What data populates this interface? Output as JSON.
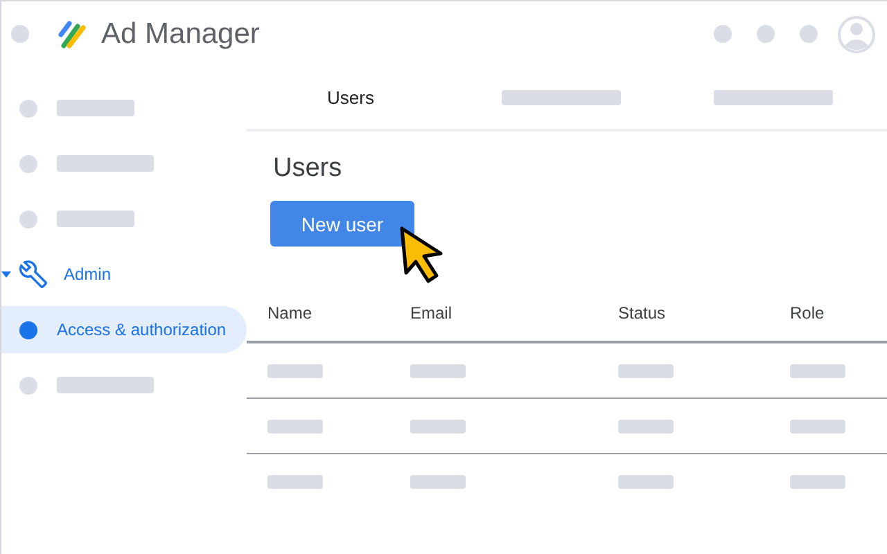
{
  "app": {
    "title": "Ad Manager"
  },
  "sidebar": {
    "items": [
      {
        "kind": "placeholder",
        "selected": false
      },
      {
        "kind": "placeholder",
        "selected": false
      },
      {
        "kind": "placeholder",
        "selected": false
      },
      {
        "kind": "section",
        "label": "Admin",
        "expanded": true,
        "selected": false
      },
      {
        "kind": "link",
        "label": "Access & authorization",
        "selected": true
      },
      {
        "kind": "placeholder",
        "selected": false
      }
    ]
  },
  "tabs": [
    {
      "kind": "text",
      "label": "Users"
    },
    {
      "kind": "placeholder"
    },
    {
      "kind": "placeholder"
    }
  ],
  "page": {
    "heading": "Users",
    "button": "New user"
  },
  "table": {
    "columns": [
      "Name",
      "Email",
      "Status",
      "Role"
    ],
    "rows": [
      {
        "kind": "placeholder"
      },
      {
        "kind": "placeholder"
      },
      {
        "kind": "placeholder"
      }
    ]
  }
}
